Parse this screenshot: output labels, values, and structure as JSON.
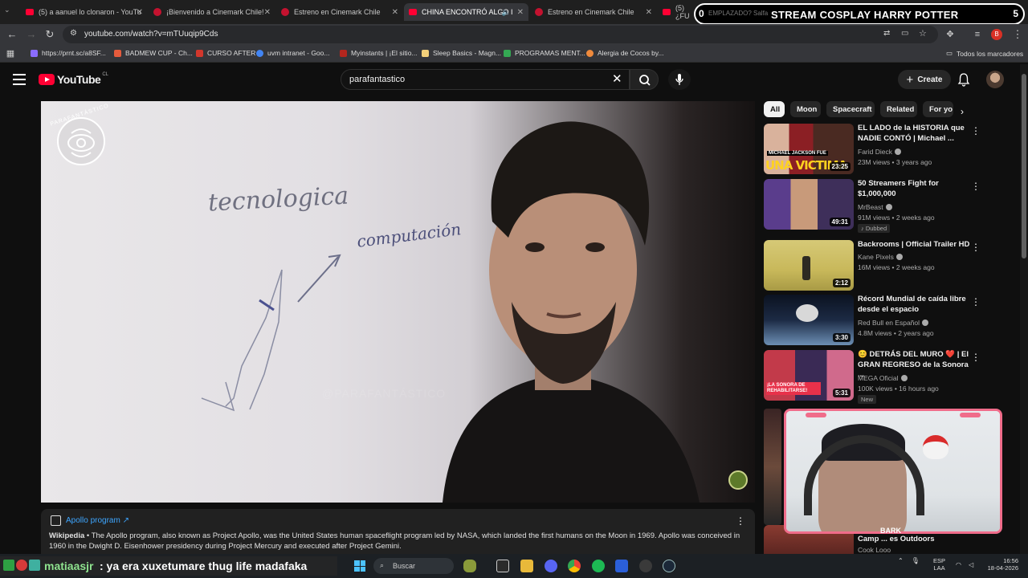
{
  "browser": {
    "tabs": [
      {
        "title": "(5) a aanuel lo clonaron - YouTu",
        "icon": "youtube-icon"
      },
      {
        "title": "¡Bienvenido a Cinemark Chile!",
        "icon": "cinemark-icon"
      },
      {
        "title": "Estreno en Cinemark Chile",
        "icon": "cinemark-icon"
      },
      {
        "title": "CHINA ENCONTRÓ ALGO I",
        "icon": "youtube-icon"
      },
      {
        "title": "Estreno en Cinemark Chile",
        "icon": "cinemark-icon"
      },
      {
        "title": "(5) ¿FU",
        "icon": "youtube-icon"
      }
    ],
    "url": "youtube.com/watch?v=mTUuqip9Cds",
    "bookmarks": [
      {
        "label": "https://prnt.sc/a8SF...",
        "color": "#8a6cff"
      },
      {
        "label": "BADMEW CUP - Ch...",
        "color": "#e55b3c"
      },
      {
        "label": "CURSO AFTER",
        "color": "#d2372c"
      },
      {
        "label": "uvm intranet - Goo...",
        "color": "#4285f4"
      },
      {
        "label": "Myinstants | ¡El sitio...",
        "color": "#b3261e"
      },
      {
        "label": "Sleep Basics - Magn...",
        "color": "#f3d07a"
      },
      {
        "label": "PROGRAMAS MENT...",
        "color": "#34a853"
      },
      {
        "label": "Alergia de Cocos by...",
        "color": "#f08a3c"
      }
    ],
    "all_bookmarks_label": "Todos los marcadores"
  },
  "stream_overlay": {
    "title": "STREAM COSPLAY HARRY POTTER",
    "left_count": "0",
    "right_count": "5",
    "ghost_text": "EMPLAZADO? Salfa"
  },
  "youtube": {
    "logo_text": "YouTube",
    "logo_region": "CL",
    "search_value": "parafantastico",
    "create_label": "Create",
    "chips": [
      "All",
      "Moon",
      "Spacecraft",
      "Related",
      "For yo"
    ],
    "video": {
      "channel_logo_text": "PARAFANTÁSTICO",
      "board_word_1": "tecnologica",
      "board_word_2": "computación",
      "watermark": "@PARAFANTÁSTICO"
    },
    "info_panel": {
      "title": "Apollo program ↗",
      "source": "Wikipedia",
      "text": " • The Apollo program, also known as Project Apollo, was the United States human spaceflight program led by NASA, which landed the first humans on the Moon in 1969. Apollo was conceived in 1960 in the Dwight D. Eisenhower presidency during Project Mercury and executed after Project Gemini."
    },
    "recommendations": [
      {
        "title": "EL LADO de la HISTORIA que NADIE CONTÓ | Michael ...",
        "channel": "Farid Dieck",
        "meta": "23M views • 3 years ago",
        "duration": "23:25",
        "thumb_text": "UNA VICTIMA",
        "thumb_sub": "MICHAEL JACKSON FUE",
        "badge": ""
      },
      {
        "title": "50 Streamers Fight for $1,000,000",
        "channel": "MrBeast",
        "meta": "91M views • 2 weeks ago",
        "duration": "49:31",
        "badge": "Dubbed"
      },
      {
        "title": "Backrooms | Official Trailer HD",
        "channel": "Kane Pixels",
        "meta": "16M views • 2 weeks ago",
        "duration": "2:12",
        "badge": ""
      },
      {
        "title": "Récord Mundial de caída libre desde el espacio",
        "channel": "Red Bull en Español",
        "meta": "4.8M views • 2 years ago",
        "duration": "3:30",
        "badge": ""
      },
      {
        "title": "😊 DETRÁS DEL MURO ❤️ | El GRAN REGRESO de la Sonora ...",
        "channel": "MEGA Oficial",
        "meta": "100K views • 16 hours ago",
        "duration": "5:31",
        "thumb_text": "¡LA SONORA DE REHABILITARSE!",
        "badge": "New"
      }
    ],
    "partial_rec": {
      "title": "Camp ... es Outdoors",
      "channel": "Cook Looo"
    }
  },
  "webcam": {
    "label": "BARK"
  },
  "chat": {
    "user": "matiaasjr",
    "message": ": ya era xuxetumare thug life madafaka"
  },
  "taskbar": {
    "search_placeholder": "Buscar",
    "lang_1": "ESP",
    "lang_2": "LAA",
    "time": "16:56",
    "date": "18-04-2026"
  }
}
